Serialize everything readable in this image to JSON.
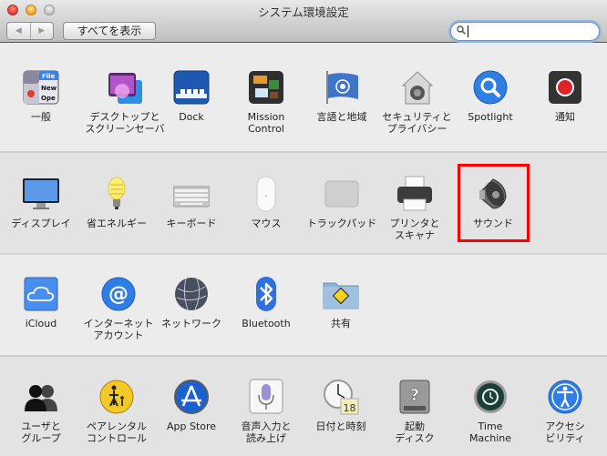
{
  "window": {
    "title": "システム環境設定",
    "back_label": "◀",
    "forward_label": "▶",
    "show_all_label": "すべてを表示",
    "search": {
      "value": "",
      "placeholder": ""
    }
  },
  "sections": [
    {
      "panes": [
        {
          "id": "general",
          "label": "一般",
          "icon": "general-icon"
        },
        {
          "id": "desktop",
          "label": "デスクトップと\nスクリーンセーバ",
          "icon": "desktop-screensaver-icon"
        },
        {
          "id": "dock",
          "label": "Dock",
          "icon": "dock-icon"
        },
        {
          "id": "mission-control",
          "label": "Mission\nControl",
          "icon": "mission-control-icon"
        },
        {
          "id": "language",
          "label": "言語と地域",
          "icon": "un-flag-icon"
        },
        {
          "id": "security",
          "label": "セキュリティと\nプライバシー",
          "icon": "security-house-icon"
        },
        {
          "id": "spotlight",
          "label": "Spotlight",
          "icon": "spotlight-magnifier-icon"
        },
        {
          "id": "notifications",
          "label": "通知",
          "icon": "notifications-record-icon"
        }
      ]
    },
    {
      "panes": [
        {
          "id": "displays",
          "label": "ディスプレイ",
          "icon": "display-monitor-icon"
        },
        {
          "id": "energy",
          "label": "省エネルギー",
          "icon": "light-bulb-icon"
        },
        {
          "id": "keyboard",
          "label": "キーボード",
          "icon": "keyboard-icon"
        },
        {
          "id": "mouse",
          "label": "マウス",
          "icon": "mouse-icon"
        },
        {
          "id": "trackpad",
          "label": "トラックパッド",
          "icon": "trackpad-icon"
        },
        {
          "id": "printers",
          "label": "プリンタと\nスキャナ",
          "icon": "printer-icon"
        },
        {
          "id": "sound",
          "label": "サウンド",
          "icon": "speaker-icon",
          "highlighted": true
        }
      ]
    },
    {
      "panes": [
        {
          "id": "icloud",
          "label": "iCloud",
          "icon": "icloud-icon"
        },
        {
          "id": "internet-accounts",
          "label": "インターネット\nアカウント",
          "icon": "at-sign-icon"
        },
        {
          "id": "network",
          "label": "ネットワーク",
          "icon": "network-globe-icon"
        },
        {
          "id": "bluetooth",
          "label": "Bluetooth",
          "icon": "bluetooth-icon"
        },
        {
          "id": "sharing",
          "label": "共有",
          "icon": "sharing-folder-icon"
        }
      ]
    },
    {
      "panes": [
        {
          "id": "users",
          "label": "ユーザと\nグループ",
          "icon": "users-groups-icon"
        },
        {
          "id": "parental",
          "label": "ペアレンタル\nコントロール",
          "icon": "parental-controls-icon"
        },
        {
          "id": "appstore",
          "label": "App Store",
          "icon": "app-store-icon"
        },
        {
          "id": "dictation",
          "label": "音声入力と\n読み上げ",
          "icon": "microphone-icon"
        },
        {
          "id": "datetime",
          "label": "日付と時刻",
          "icon": "clock-calendar-icon",
          "calendar_day": "18"
        },
        {
          "id": "startup",
          "label": "起動\nディスク",
          "icon": "startup-disk-icon",
          "disk_glyph": "?"
        },
        {
          "id": "timemachine",
          "label": "Time\nMachine",
          "icon": "time-machine-icon"
        },
        {
          "id": "accessibility",
          "label": "アクセシ\nビリティ",
          "icon": "accessibility-icon"
        }
      ]
    }
  ],
  "general_icon_text": [
    "File",
    "New",
    "Ope"
  ],
  "colors": {
    "highlight": "#ff0000",
    "accent": "#2f7ee6"
  }
}
